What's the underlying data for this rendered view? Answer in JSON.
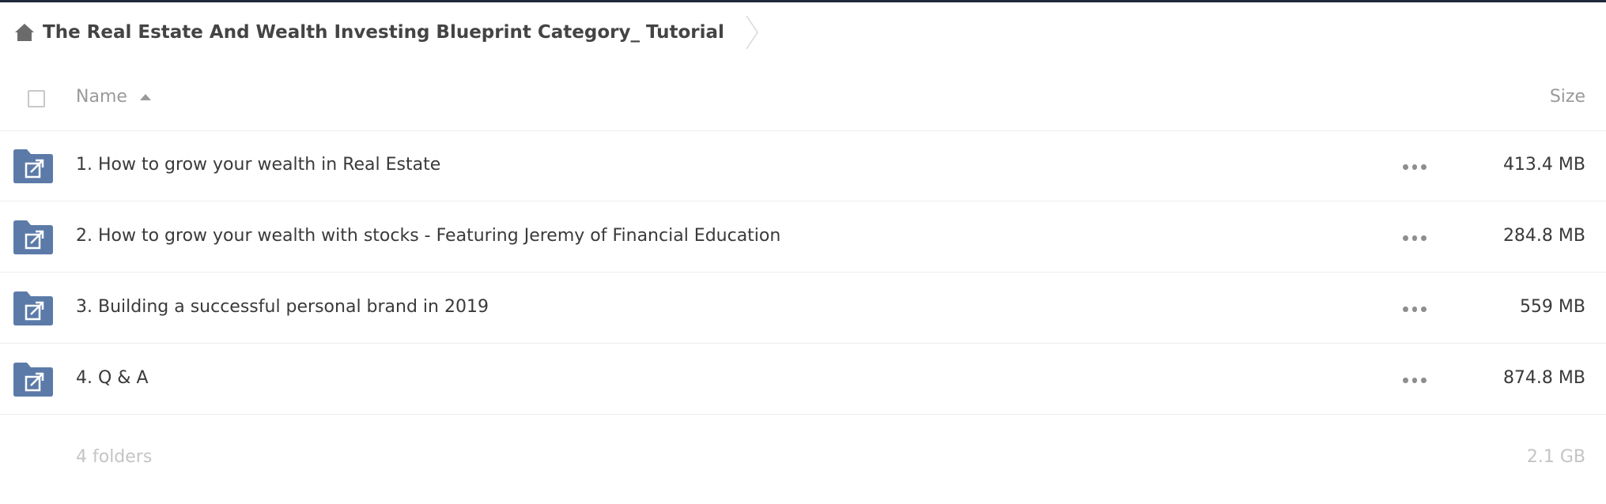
{
  "colors": {
    "folder": "#5b7aa8",
    "text": "#3a3a3a",
    "muted": "#9a9a9a",
    "footer": "#c4c4c4",
    "divider": "#ececec"
  },
  "breadcrumb": {
    "home_icon": "home-icon",
    "title": "The Real Estate And Wealth Investing Blueprint Category_ Tutorial"
  },
  "header": {
    "name_label": "Name",
    "sort": "ascending",
    "size_label": "Size"
  },
  "rows": [
    {
      "name": "1. How to grow your wealth in Real Estate",
      "size": "413.4 MB",
      "icon": "shared-folder-icon"
    },
    {
      "name": "2. How to grow your wealth with stocks - Featuring Jeremy of Financial Education",
      "size": "284.8 MB",
      "icon": "shared-folder-icon"
    },
    {
      "name": "3. Building a successful personal brand in 2019",
      "size": "559 MB",
      "icon": "shared-folder-icon"
    },
    {
      "name": "4. Q & A",
      "size": "874.8 MB",
      "icon": "shared-folder-icon"
    }
  ],
  "footer": {
    "count": "4 folders",
    "total_size": "2.1 GB"
  }
}
